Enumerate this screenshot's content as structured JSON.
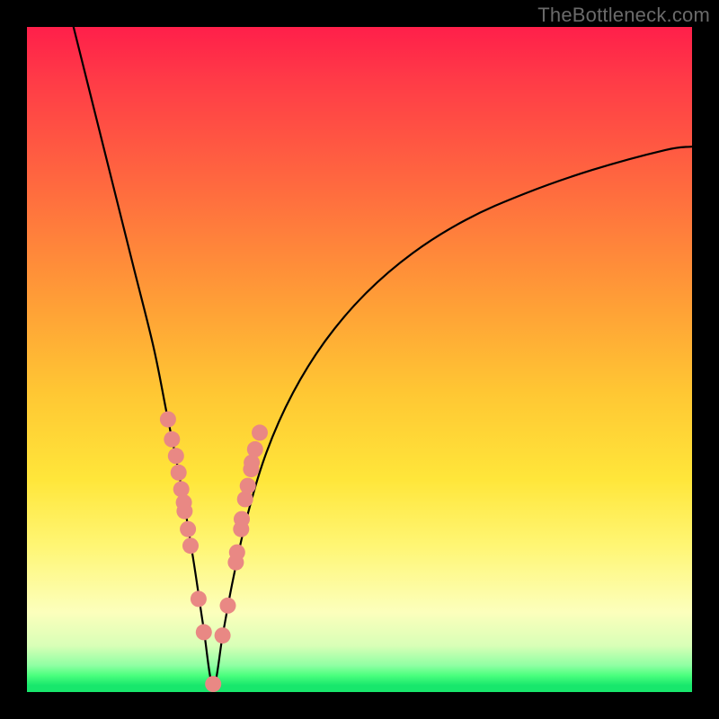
{
  "watermark": "TheBottleneck.com",
  "colors": {
    "frame": "#000000",
    "curve": "#000000",
    "dot": "#e98884",
    "gradient_stops": [
      "#ff1f4a",
      "#ff3b47",
      "#ff6a3f",
      "#ff9a37",
      "#ffc733",
      "#ffe63a",
      "#fff674",
      "#fcffbc",
      "#d9ffb7",
      "#8fffa3",
      "#4bff7e",
      "#18e76c"
    ]
  },
  "chart_data": {
    "type": "line",
    "title": "",
    "xlabel": "",
    "ylabel": "",
    "xlim": [
      0,
      100
    ],
    "ylim": [
      0,
      100
    ],
    "description": "Bottleneck curve: y ≈ 100 at the edges dropping to ≈0 at x≈28 (asymmetric V, steeper on the left).",
    "series": [
      {
        "name": "bottleneck-curve",
        "x": [
          7,
          10,
          13,
          16,
          19,
          21,
          23,
          25,
          26.5,
          28,
          29.5,
          31,
          33,
          36,
          40,
          45,
          51,
          58,
          66,
          75,
          85,
          96,
          100
        ],
        "y": [
          100,
          88,
          76,
          64,
          52,
          42,
          32,
          20,
          10,
          1,
          9,
          17,
          26,
          36,
          45,
          53,
          60,
          66,
          71,
          75,
          78.5,
          81.5,
          82
        ]
      }
    ],
    "markers": {
      "name": "highlight-dots",
      "x": [
        21.2,
        21.8,
        22.4,
        22.8,
        23.2,
        23.6,
        23.7,
        24.2,
        24.6,
        25.8,
        26.6,
        28.0,
        29.4,
        30.2,
        31.4,
        31.6,
        32.2,
        32.3,
        32.8,
        33.2,
        33.7,
        33.8,
        34.3,
        35.0
      ],
      "y": [
        41.0,
        38.0,
        35.5,
        33.0,
        30.5,
        28.5,
        27.2,
        24.5,
        22.0,
        14.0,
        9.0,
        1.2,
        8.5,
        13.0,
        19.5,
        21.0,
        24.5,
        26.0,
        29.0,
        31.0,
        33.5,
        34.5,
        36.5,
        39.0
      ]
    }
  }
}
